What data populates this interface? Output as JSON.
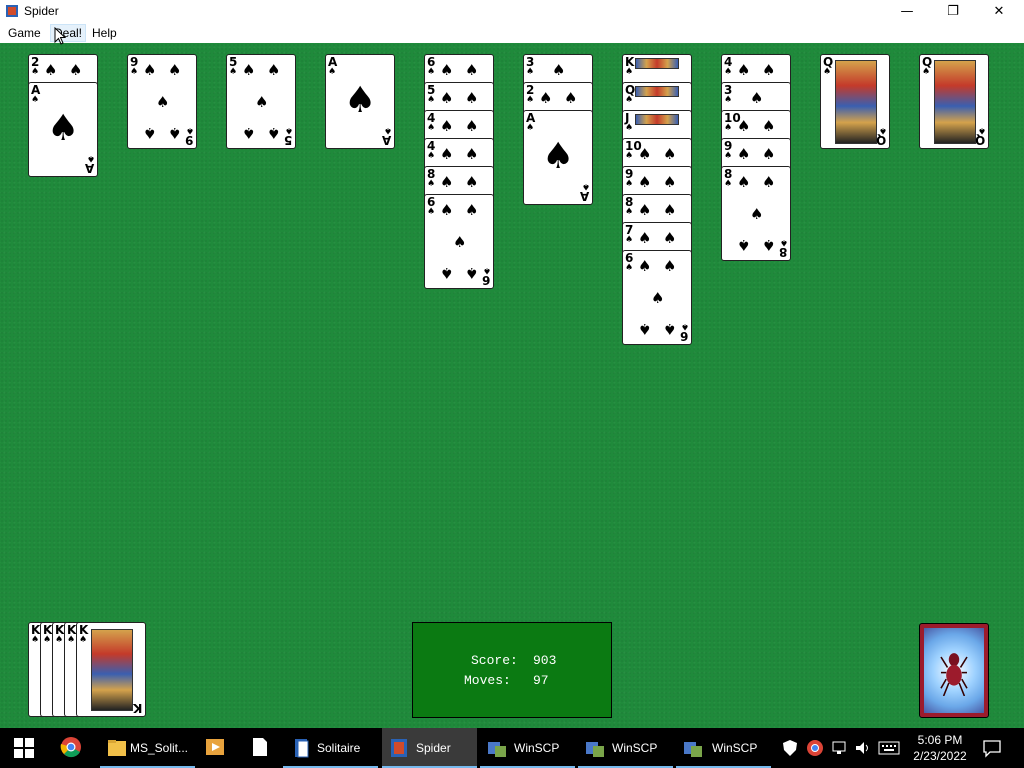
{
  "window": {
    "title": "Spider",
    "minimize_glyph": "—",
    "restore_glyph": "❐",
    "close_glyph": "✕"
  },
  "menu": {
    "items": [
      "Game",
      "Deal!",
      "Help"
    ]
  },
  "stock": {
    "ranks": [
      "K",
      "K",
      "K",
      "K",
      "K"
    ]
  },
  "score": {
    "score_label": "Score:",
    "score_value": "903",
    "moves_label": "Moves:",
    "moves_value": "97"
  },
  "tableau": [
    {
      "cards": [
        "2",
        "A"
      ]
    },
    {
      "cards": [
        "9"
      ]
    },
    {
      "cards": [
        "5"
      ]
    },
    {
      "cards": [
        "A"
      ]
    },
    {
      "cards": [
        "6",
        "5",
        "4",
        "4",
        "8",
        "6"
      ]
    },
    {
      "cards": [
        "3",
        "2",
        "A"
      ]
    },
    {
      "cards": [
        "K",
        "Q",
        "J",
        "10",
        "9",
        "8",
        "7",
        "6"
      ]
    },
    {
      "cards": [
        "4",
        "3",
        "10",
        "9",
        "8"
      ]
    },
    {
      "cards": [
        "Q"
      ]
    },
    {
      "cards": [
        "Q"
      ]
    }
  ],
  "suit_symbol": "♠",
  "taskbar": {
    "items": [
      "MS_Solit...",
      "Solitaire",
      "Spider",
      "WinSCP",
      "WinSCP",
      "WinSCP"
    ],
    "time": "5:06 PM",
    "date": "2/23/2022"
  },
  "colors": {
    "felt": "#1f8a3b",
    "score_bg": "#0b7a12",
    "taskbar": "#000000",
    "card_back": "#9c1b2c"
  }
}
